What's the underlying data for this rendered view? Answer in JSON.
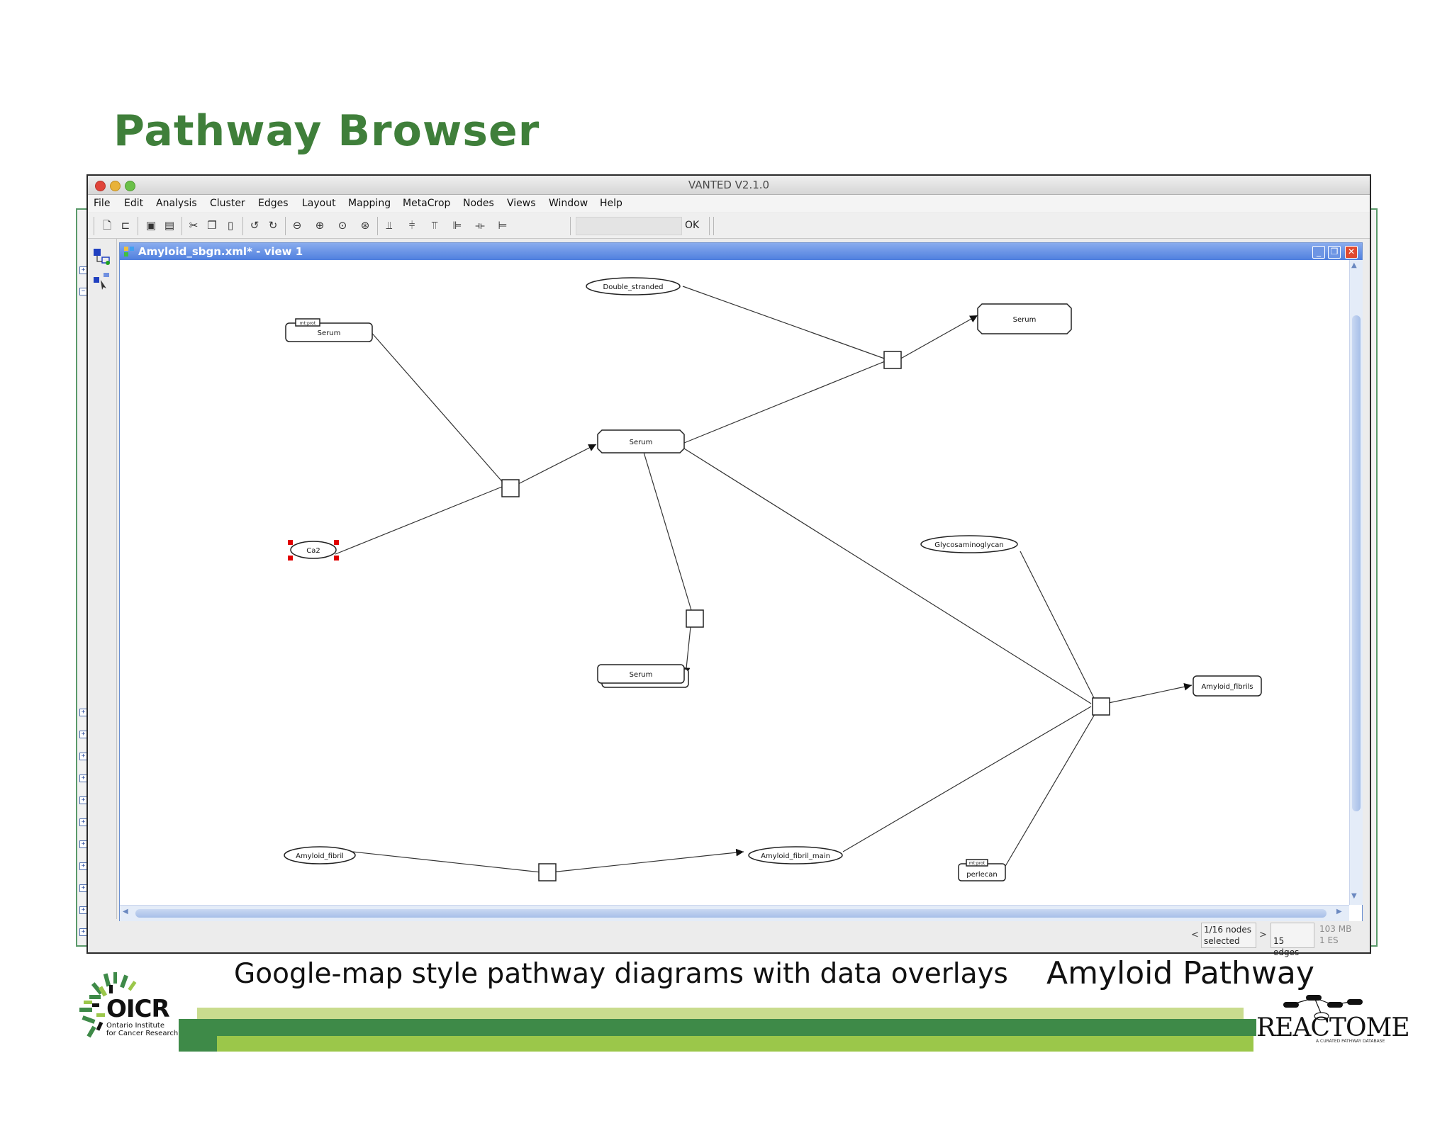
{
  "slide": {
    "title": "Pathway Browser",
    "caption": "Google-map style pathway diagrams with data overlays",
    "pathway_label": "Amyloid Pathway",
    "logos": {
      "oicr": "OICR",
      "oicr_sub_1": "Ontario Institute",
      "oicr_sub_2": "for Cancer Research",
      "reactome": "REACTOME",
      "reactome_sub": "A CURATED PATHWAY DATABASE"
    }
  },
  "app": {
    "title": "VANTED V2.1.0",
    "menu": [
      "File",
      "Edit",
      "Analysis",
      "Cluster",
      "Edges",
      "Layout",
      "Mapping",
      "MetaCrop",
      "Nodes",
      "Views",
      "Window",
      "Help"
    ],
    "toolbar_ok": "OK",
    "view_title": "Amyloid_sbgn.xml* - view 1",
    "status": {
      "nodes_line1": "1/16 nodes",
      "nodes_line2": "selected",
      "edges": "15 edges",
      "memory_line1": "103 MB",
      "memory_line2": "1 ES"
    },
    "colors": {
      "title_green": "#3f7f3a",
      "inner_titlebar": "#4f7fde",
      "selection": "#e00000"
    }
  },
  "diagram": {
    "nodes": [
      {
        "label": "Double_stranded"
      },
      {
        "label": "Serum"
      },
      {
        "label": "Serum",
        "tag": "mt:prot"
      },
      {
        "label": "Serum"
      },
      {
        "label": "Ca2"
      },
      {
        "label": "Serum"
      },
      {
        "label": "Glycosaminoglycan"
      },
      {
        "label": "Amyloid_fibrils"
      },
      {
        "label": "Amyloid_fibril"
      },
      {
        "label": "Amyloid_fibril_main"
      },
      {
        "label": "perlecan",
        "tag": "mt:prot"
      }
    ]
  }
}
